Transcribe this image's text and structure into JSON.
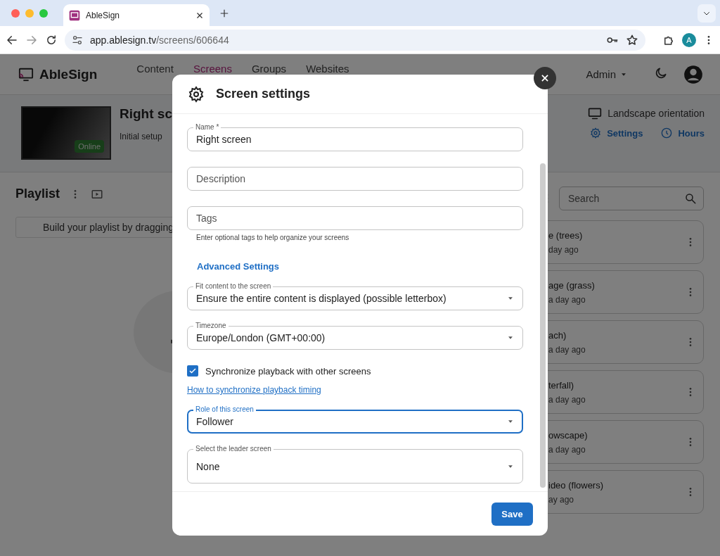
{
  "browser": {
    "tab_title": "AbleSign",
    "url_host": "app.ablesign.tv",
    "url_path": "/screens/606644",
    "profile_initial": "A"
  },
  "app": {
    "logo": "AbleSign",
    "nav": [
      {
        "label": "Content",
        "selected": false
      },
      {
        "label": "Screens",
        "selected": true
      },
      {
        "label": "Groups",
        "selected": false
      },
      {
        "label": "Websites",
        "selected": false
      }
    ],
    "user_menu": "Admin"
  },
  "screen": {
    "title": "Right sc",
    "description": "Initial setup",
    "status": "Online",
    "orientation": "Landscape orientation",
    "actions": [
      {
        "kind": "settings",
        "label": "Settings"
      },
      {
        "kind": "hours",
        "label": "Hours"
      }
    ]
  },
  "playlist": {
    "title": "Playlist",
    "hint": "Build your playlist by dragging"
  },
  "library": {
    "search": {
      "placeholder": "Search"
    },
    "items": [
      {
        "title": "e (trees)",
        "subtitle": "day ago"
      },
      {
        "title": "age (grass)",
        "subtitle": "a day ago"
      },
      {
        "title": "ach)",
        "subtitle": "a day ago"
      },
      {
        "title": "terfall)",
        "subtitle": "a day ago"
      },
      {
        "title": "owscape)",
        "subtitle": "a day ago"
      },
      {
        "title": "ideo (flowers)",
        "subtitle": "ay ago"
      }
    ]
  },
  "dialog": {
    "title": "Screen settings",
    "fields": [
      {
        "kind": "text",
        "label": "Name *",
        "value": "Right screen",
        "focused": false
      },
      {
        "kind": "text",
        "placeholder": "Description",
        "focused": false
      },
      {
        "kind": "text",
        "placeholder": "Tags",
        "helper": "Enter optional tags to help organize your screens",
        "focused": false
      },
      {
        "kind": "section",
        "text": "Advanced Settings"
      },
      {
        "kind": "select",
        "label": "Fit content to the screen",
        "value": "Ensure the entire content is displayed (possible letterbox)",
        "focused": false
      },
      {
        "kind": "select",
        "label": "Timezone",
        "value": "Europe/London (GMT+00:00)",
        "focused": false
      },
      {
        "kind": "checkbox",
        "label": "Synchronize playback with other screens",
        "checked": true
      },
      {
        "kind": "link",
        "text": "How to synchronize playback timing"
      },
      {
        "kind": "select",
        "label": "Role of this screen",
        "value": "Follower",
        "focused": true
      },
      {
        "kind": "select",
        "label": "Select the leader screen",
        "value": "None",
        "focused": false
      }
    ],
    "save": "Save"
  }
}
